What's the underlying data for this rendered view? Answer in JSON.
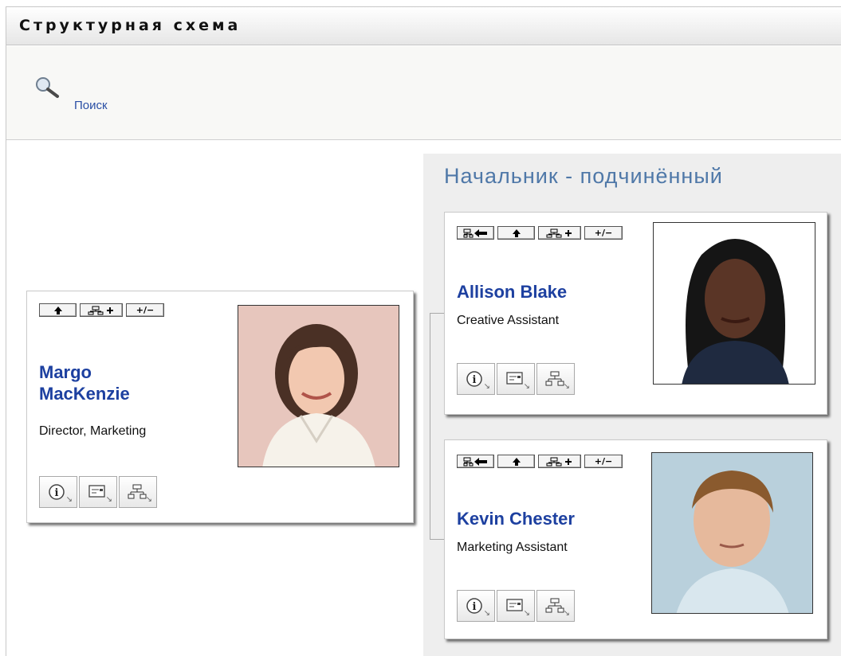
{
  "header": {
    "title": "Структурная схема"
  },
  "search": {
    "label": "Поиск"
  },
  "team": {
    "title": "Начальник - подчинённый"
  },
  "actions": {
    "toggle_label": "+/−"
  },
  "people": {
    "margo": {
      "first_name": "Margo",
      "last_name": "MacKenzie",
      "title": "Director, Marketing"
    },
    "allison": {
      "name": "Allison Blake",
      "title": "Creative Assistant"
    },
    "kevin": {
      "name": "Kevin Chester",
      "title": "Marketing Assistant"
    }
  },
  "colors": {
    "link": "#1d40a0",
    "team_title": "#4f78a8",
    "panel": "#eeeeee"
  }
}
